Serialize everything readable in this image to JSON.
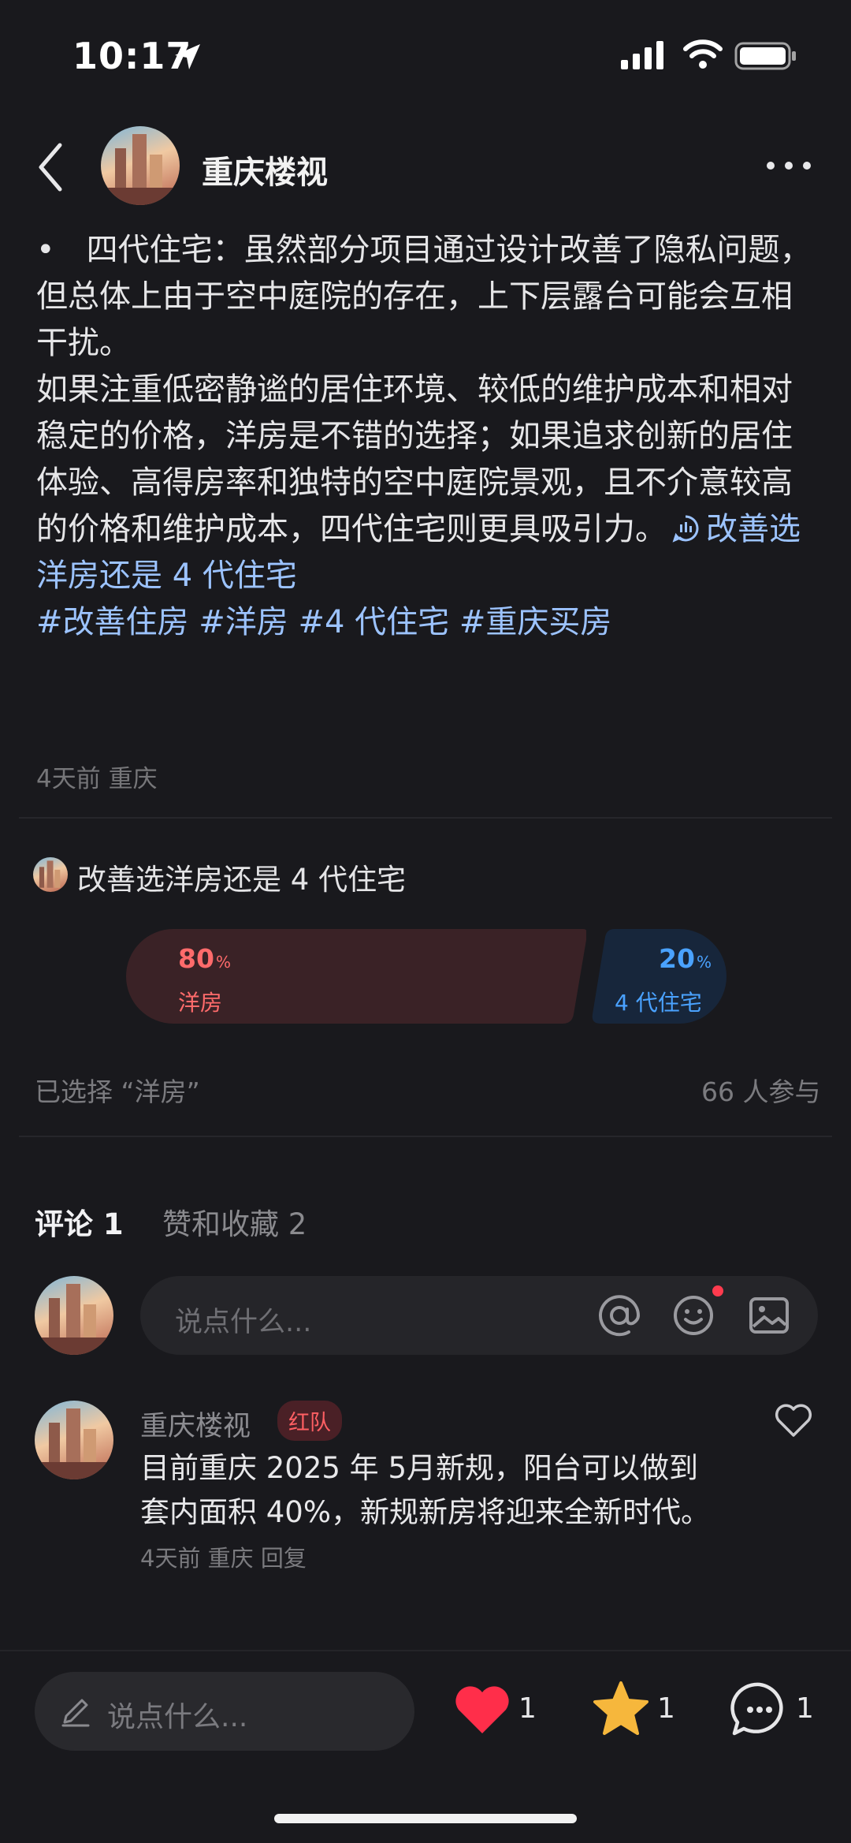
{
  "status_bar": {
    "time": "10:17"
  },
  "header": {
    "author": "重庆楼视"
  },
  "post": {
    "bullet_text": "•　四代住宅：虽然部分项目通过设计改善了隐私问题，但总体上由于空中庭院的存在，上下层露台可能会互相干扰。",
    "body_text": "如果注重低密静谧的居住环境、较低的维护成本和相对稳定的价格，洋房是不错的选择；如果追求创新的居住体验、高得房率和独特的空中庭院景观，且不介意较高的价格和维护成本，四代住宅则更具吸引力。",
    "poll_link": "改善选洋房还是 4 代住宅",
    "tags": [
      "#改善住房",
      "#洋房",
      "#4 代住宅",
      "#重庆买房"
    ],
    "meta": "4天前 重庆"
  },
  "poll": {
    "title": "改善选洋房还是 4 代住宅",
    "option_a": {
      "percent": "80",
      "label": "洋房"
    },
    "option_b": {
      "percent": "20",
      "label": "4 代住宅"
    },
    "percent_unit": "%",
    "chosen": "已选择 “洋房”",
    "participants": "66 人参与"
  },
  "tabs": {
    "comments": "评论 1",
    "likes": "赞和收藏 2"
  },
  "comment_input": {
    "placeholder": "说点什么..."
  },
  "comment": {
    "author": "重庆楼视",
    "badge": "红队",
    "text": "目前重庆 2025 年 5月新规，阳台可以做到套内面积 40%，新规新房将迎来全新时代。",
    "meta": "4天前 重庆 回复"
  },
  "bottom_bar": {
    "placeholder": "说点什么...",
    "like_count": "1",
    "star_count": "1",
    "comment_count": "1"
  },
  "colors": {
    "background": "#19191d",
    "accent_red": "#ff6b6b",
    "accent_blue": "#4aa2ff",
    "tag_blue": "#9cc3ff"
  }
}
